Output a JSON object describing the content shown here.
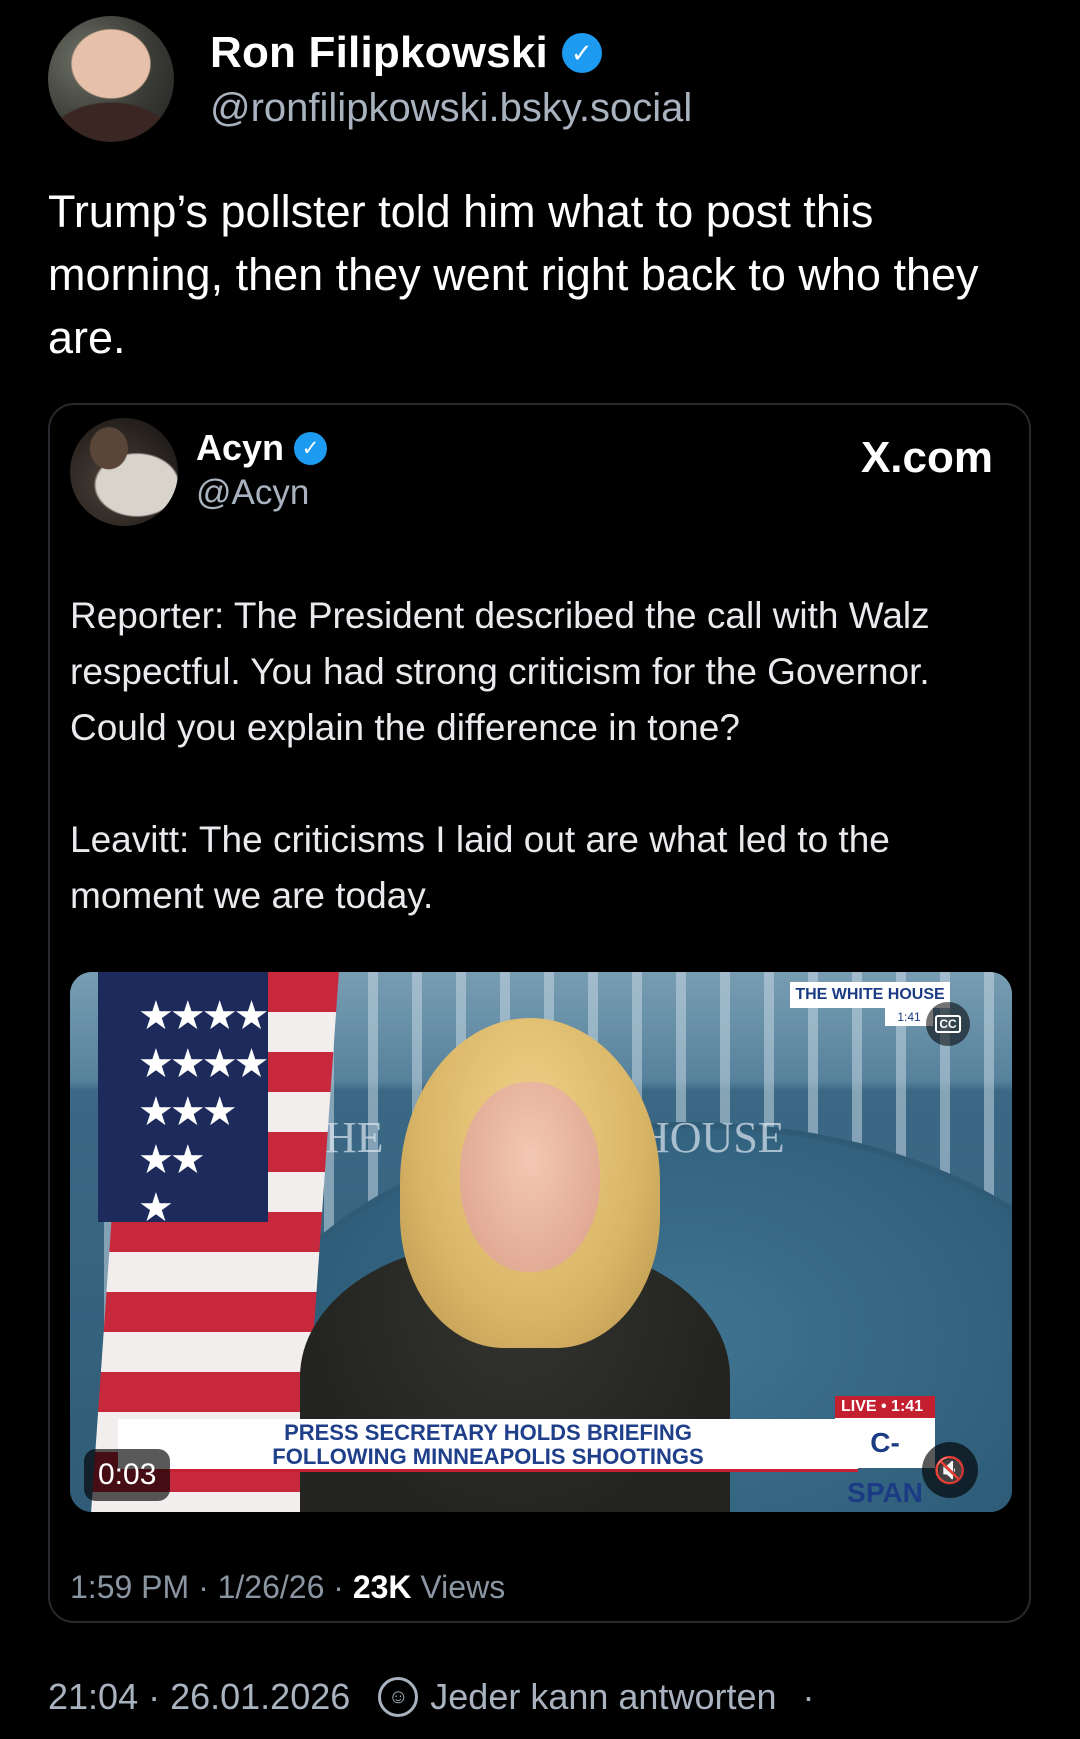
{
  "post": {
    "author": {
      "display_name": "Ron Filipkowski",
      "handle": "@ronfilipkowski.bsky.social",
      "verified": true
    },
    "text": "Trump’s pollster told him what to post this morning, then they went right back to who they are.",
    "embed": {
      "author": {
        "display_name": "Acyn",
        "handle": "@Acyn",
        "verified": true
      },
      "source": "X.com",
      "text": "Reporter: The President described the call with Walz respectful. You had strong criticism for the Governor. Could you explain the difference in tone?\n\nLeavitt: The criticisms I laid out are what led to the moment we are today.",
      "video": {
        "duration": "0:03",
        "chyron_line1": "PRESS SECRETARY HOLDS BRIEFING",
        "chyron_line2": "FOLLOWING MINNEAPOLIS SHOOTINGS",
        "network": "C-SPAN",
        "live_label": "LIVE • 1:41",
        "bug_text": "THE WHITE HOUSE",
        "bug_time": "1:41",
        "wall_word_left": "THE",
        "wall_word_right": "HOUSE",
        "cc_label": "CC",
        "mute_icon": "speaker-muted-icon"
      },
      "meta": {
        "time": "1:59 PM",
        "date": "1/26/26",
        "views_count": "23K",
        "views_label": "Views"
      }
    },
    "meta": {
      "time": "21:04",
      "date": "26.01.2026",
      "reply_setting": "Jeder kann antworten"
    }
  },
  "colors": {
    "background": "#000000",
    "verified_badge": "#1d9bf0",
    "secondary_text": "#a8b3bf"
  }
}
